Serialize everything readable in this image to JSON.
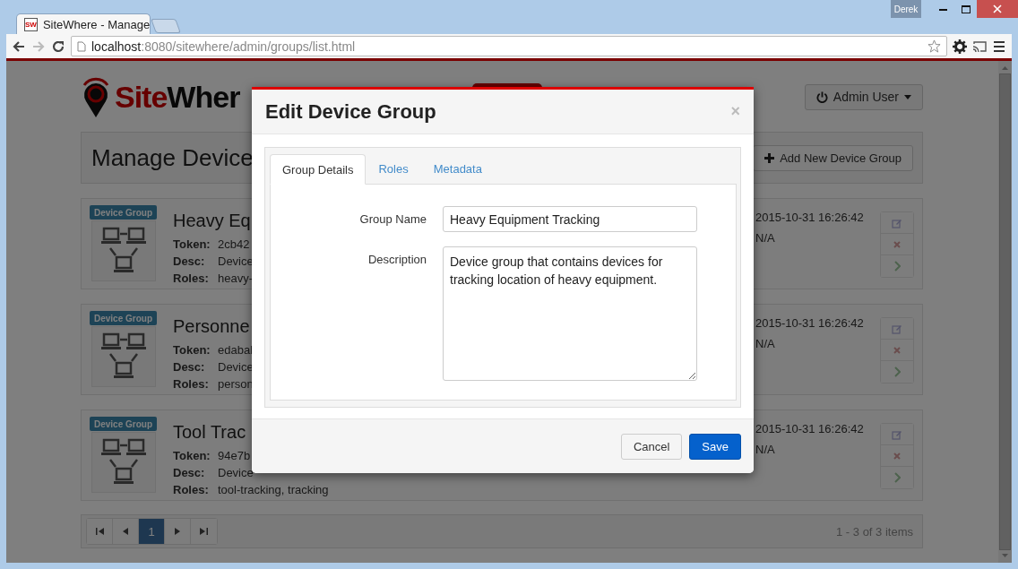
{
  "browser": {
    "tab": {
      "favicon_text": "SW",
      "title": "SiteWhere - Manage"
    },
    "url_host": "localhost",
    "url_path": ":8080/sitewhere/admin/groups/list.html",
    "profile": "Derek"
  },
  "header": {
    "logo_red": "Site",
    "logo_dark": "Wher",
    "user_menu": "Admin User"
  },
  "page": {
    "title": "Manage Device",
    "add_button": "Add New Device Group"
  },
  "groups": [
    {
      "badge": "Device Group",
      "name": "Heavy Eq",
      "token_label": "Token:",
      "token": "2cb42",
      "desc_label": "Desc:",
      "desc": "Device",
      "roles_label": "Roles:",
      "roles": "heavy-",
      "created": "2015-10-31 16:26:42",
      "updated": "N/A"
    },
    {
      "badge": "Device Group",
      "name": "Personne",
      "token_label": "Token:",
      "token": "edabal",
      "desc_label": "Desc:",
      "desc": "Device",
      "roles_label": "Roles:",
      "roles": "person",
      "created": "2015-10-31 16:26:42",
      "updated": "N/A"
    },
    {
      "badge": "Device Group",
      "name": "Tool Trac",
      "token_label": "Token:",
      "token": "94e7b",
      "desc_label": "Desc:",
      "desc": "Device",
      "roles_label": "Roles:",
      "roles": "tool-tracking, tracking",
      "created": "2015-10-31 16:26:42",
      "updated": "N/A"
    }
  ],
  "pagination": {
    "pages": [
      {
        "label": "1",
        "selected": true
      }
    ],
    "summary": "1 - 3 of 3 items"
  },
  "dialog": {
    "title": "Edit Device Group",
    "close": "×",
    "tabs": [
      {
        "label": "Group Details",
        "selected": true
      },
      {
        "label": "Roles",
        "selected": false
      },
      {
        "label": "Metadata",
        "selected": false
      }
    ],
    "fields": [
      {
        "label": "Group Name",
        "kind": "input",
        "value": "Heavy Equipment Tracking"
      },
      {
        "label": "Description",
        "kind": "textarea",
        "value": "Device group that contains devices for tracking location of heavy equipment."
      }
    ],
    "buttons": [
      {
        "label": "Cancel",
        "kind": "default"
      },
      {
        "label": "Save",
        "kind": "primary"
      }
    ]
  }
}
